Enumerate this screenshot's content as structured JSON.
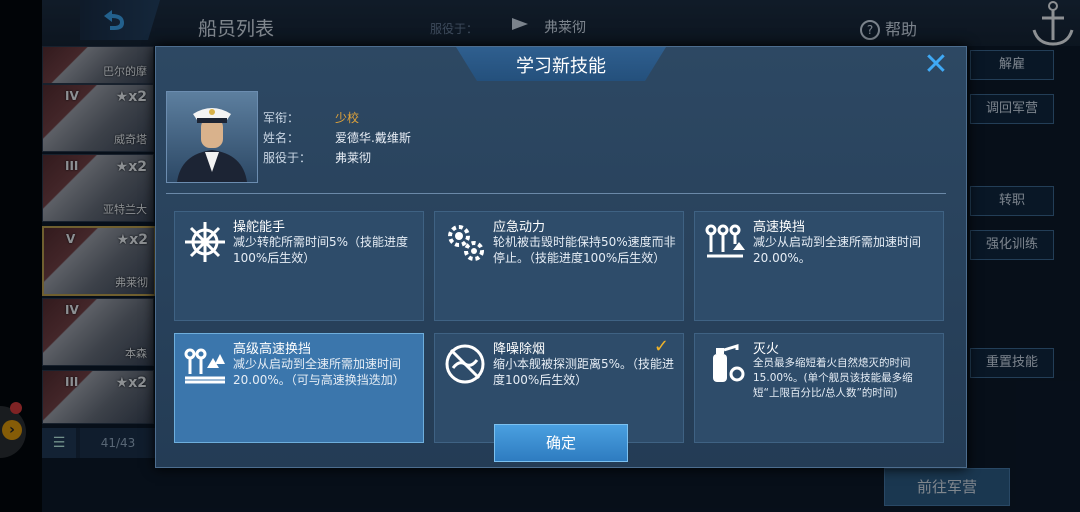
{
  "header": {
    "title": "船员列表",
    "serve_label": "服役于：",
    "serve_ship": "弗莱彻",
    "help": "帮助"
  },
  "ship_list": [
    {
      "name": "巴尔的摩",
      "tier": "",
      "star": ""
    },
    {
      "name": "威奇塔",
      "tier": "IV",
      "star": "★x2"
    },
    {
      "name": "亚特兰大",
      "tier": "III",
      "star": "★x2"
    },
    {
      "name": "弗莱彻",
      "tier": "V",
      "star": "★x2"
    },
    {
      "name": "本森",
      "tier": "IV",
      "star": ""
    },
    {
      "name": "",
      "tier": "III",
      "star": "★x2"
    }
  ],
  "list_count": "41/43",
  "right_buttons": [
    "解雇",
    "调回军营",
    "转职",
    "强化训练",
    "重置技能"
  ],
  "go_barracks": "前往军营",
  "modal": {
    "title": "学习新技能",
    "close": "✕",
    "officer": {
      "rank_label": "军衔：",
      "rank": "少校",
      "name_label": "姓名：",
      "name": "爱德华.戴维斯",
      "serve_label": "服役于：",
      "serve": "弗莱彻"
    },
    "skills": [
      {
        "name": "操舵能手",
        "desc": "减少转舵所需时间5%（技能进度100%后生效）",
        "icon": "helm-icon"
      },
      {
        "name": "应急动力",
        "desc": "轮机被击毁时能保持50%速度而非停止。（技能进度100%后生效）",
        "icon": "gears-icon"
      },
      {
        "name": "高速换挡",
        "desc": "减少从启动到全速所需加速时间20.00%。",
        "icon": "gear-shift-icon"
      },
      {
        "name": "高级高速换挡",
        "desc": "减少从启动到全速所需加速时间20.00%。（可与高速换挡迭加）",
        "icon": "advanced-shift-icon"
      },
      {
        "name": "降噪除烟",
        "desc": "缩小本舰被探测距离5%。（技能进度100%后生效）",
        "icon": "stealth-icon"
      },
      {
        "name": "灭火",
        "desc": "全员最多缩短着火自然熄灭的时间15.00%。(单个舰员该技能最多缩短“上限百分比/总人数”的时间)",
        "icon": "extinguisher-icon"
      }
    ],
    "confirm": "确定"
  }
}
